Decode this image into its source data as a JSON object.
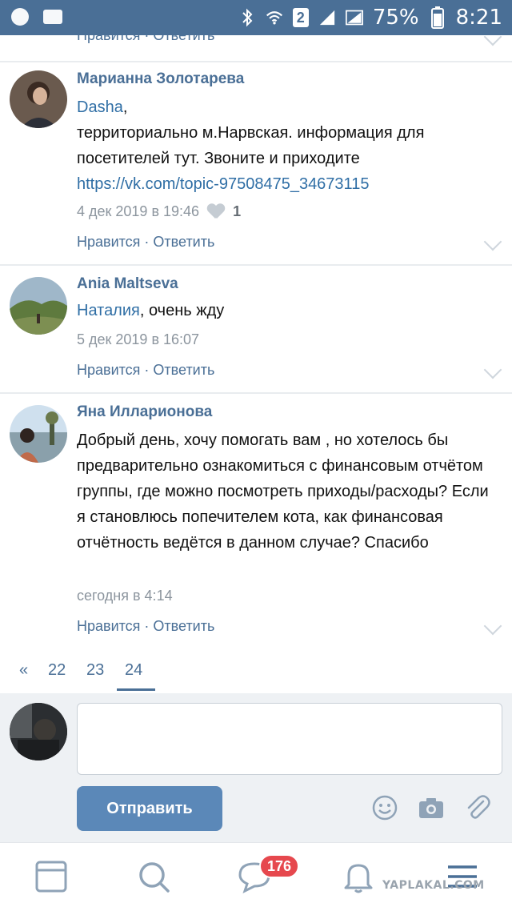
{
  "status_bar": {
    "battery": "75%",
    "time": "8:21",
    "sim": "2"
  },
  "top_partial": {
    "actions": "Нравится · Ответить"
  },
  "comments": [
    {
      "author": "Марианна Золотарева",
      "mention": "Dasha",
      "text_after_mention": ",",
      "body": "территориально м.Нарвская. информация для посетителей тут. Звоните и приходите",
      "link": "https://vk.com/topic-97508475_34673115",
      "date": "4 дек 2019 в 19:46",
      "likes": "1",
      "actions": "Нравится · Ответить"
    },
    {
      "author": "Ania Maltseva",
      "mention": "Наталия",
      "text_after_mention": ", очень жду",
      "date": "5 дек 2019 в 16:07",
      "actions": "Нравится · Ответить"
    },
    {
      "author": "Яна Илларионова",
      "body": "Добрый день, хочу помогать вам , но хотелось бы предварительно ознакомиться с финансовым отчётом группы, где можно посмотреть приходы/расходы? Если я становлюсь попечителем кота, как финансовая отчётность ведётся в данном случае? Спасибо",
      "date": "сегодня в 4:14",
      "actions": "Нравится · Ответить"
    }
  ],
  "pager": {
    "prev": "«",
    "pages": [
      "22",
      "23",
      "24"
    ],
    "active": "24"
  },
  "compose": {
    "placeholder": "",
    "send_label": "Отправить"
  },
  "bottom_nav": {
    "messages_badge": "176"
  },
  "watermark": "YAPLAKAL.COM",
  "colors": {
    "accent": "#4a6f96",
    "link": "#2f6ea5",
    "button": "#5b88b8",
    "badge": "#e6484e"
  }
}
